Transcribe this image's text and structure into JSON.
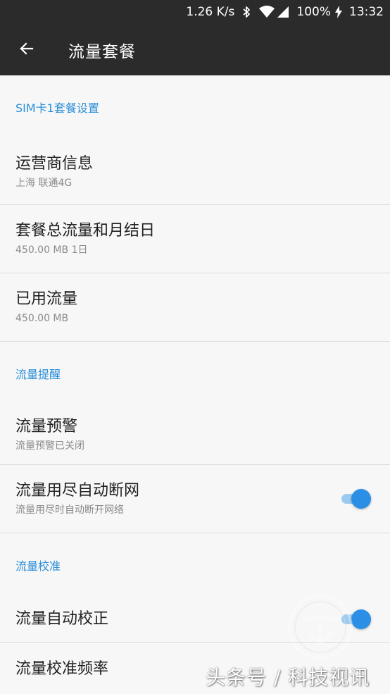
{
  "status_bar": {
    "speed": "1.26 K/s",
    "battery": "100%",
    "time": "13:32",
    "icons": [
      "bluetooth-icon",
      "wifi-icon",
      "signal-icon",
      "charging-icon"
    ]
  },
  "app_bar": {
    "title": "流量套餐",
    "back_icon": "arrow-left-icon"
  },
  "sections": [
    {
      "header": "SIM卡1套餐设置",
      "items": [
        {
          "title": "运营商信息",
          "summary": "上海 联通4G"
        },
        {
          "title": "套餐总流量和月结日",
          "summary": "450.00 MB 1日"
        },
        {
          "title": "已用流量",
          "summary": "450.00 MB"
        }
      ]
    },
    {
      "header": "流量提醒",
      "items": [
        {
          "title": "流量预警",
          "summary": "流量预警已关闭"
        },
        {
          "title": "流量用尽自动断网",
          "summary": "流量用尽时自动断开网络",
          "toggle": true
        }
      ]
    },
    {
      "header": "流量校准",
      "items": [
        {
          "title": "流量自动校正",
          "toggle": true
        },
        {
          "title": "流量校准频率"
        }
      ]
    }
  ],
  "watermark": "头条号 / 科技视讯",
  "colors": {
    "accent": "#2b8fd8",
    "toolbar": "#2b2b2b",
    "background": "#f7f7f7"
  }
}
